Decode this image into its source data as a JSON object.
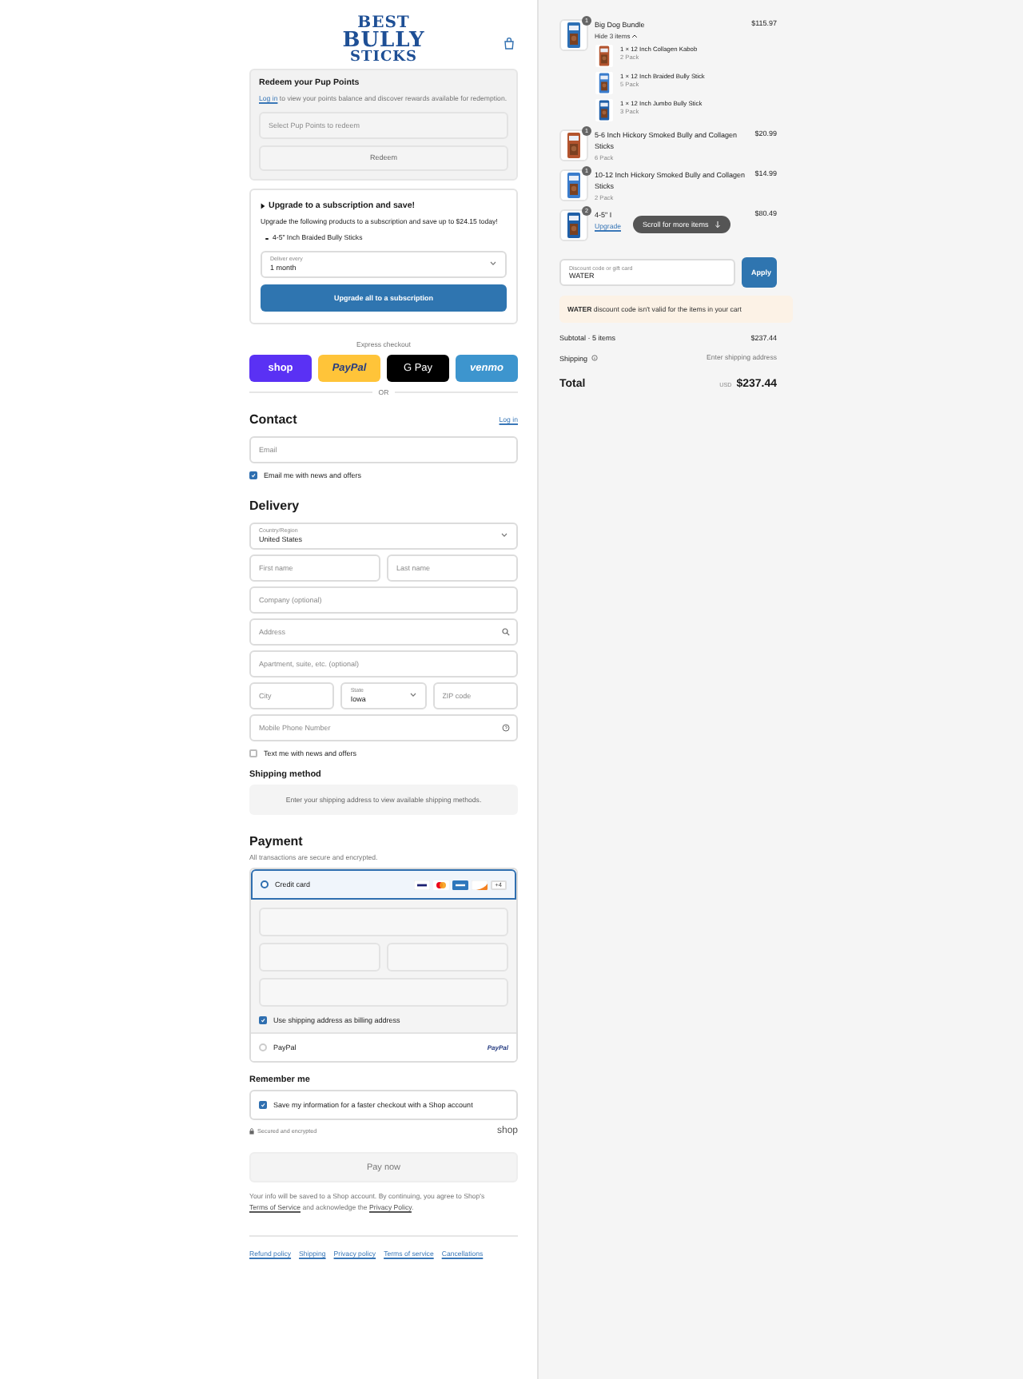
{
  "header": {
    "logo": [
      "BEST",
      "BULLY",
      "STICKS"
    ]
  },
  "points": {
    "title": "Redeem your Pup Points",
    "login_link": "Log in",
    "text": " to view your points balance and discover rewards available for redemption.",
    "select": {
      "placeholder": "Select Pup Points to redeem"
    },
    "button": "Redeem"
  },
  "upsell": {
    "title": "Upgrade to a subscription and save!",
    "text": "Upgrade the following products to a subscription and save up to $24.15 today!",
    "products": [
      "4-5\" Inch Braided Bully Sticks"
    ],
    "select_label": "Deliver every",
    "select_value": "1 month",
    "button": "Upgrade all to a subscription"
  },
  "express": {
    "title": "Express checkout",
    "buttons": [
      {
        "kind": "shop",
        "label": "shop"
      },
      {
        "kind": "paypal",
        "label": "PayPal"
      },
      {
        "kind": "gpay",
        "label": "G Pay"
      },
      {
        "kind": "venmo",
        "label": "venmo"
      }
    ],
    "or": "OR"
  },
  "contact": {
    "title": "Contact",
    "login": "Log in",
    "email": {
      "placeholder": "Email"
    },
    "news": {
      "label": "Email me with news and offers",
      "checked": true
    }
  },
  "delivery": {
    "title": "Delivery",
    "country_label": "Country/Region",
    "country": "United States",
    "first": {
      "placeholder": "First name"
    },
    "last": {
      "placeholder": "Last name"
    },
    "company": {
      "placeholder": "Company (optional)"
    },
    "address": {
      "placeholder": "Address"
    },
    "apartment": {
      "placeholder": "Apartment, suite, etc. (optional)"
    },
    "city": {
      "placeholder": "City"
    },
    "state_label": "State",
    "state": "Iowa",
    "zip": {
      "placeholder": "ZIP code"
    },
    "phone": {
      "placeholder": "Mobile Phone Number"
    },
    "text_me": {
      "label": "Text me with news and offers",
      "checked": false
    }
  },
  "shipping": {
    "title": "Shipping method",
    "notice": "Enter your shipping address to view available shipping methods."
  },
  "payment": {
    "title": "Payment",
    "subtitle": "All transactions are secure and encrypted.",
    "methods": [
      {
        "kind": "card",
        "label": "Credit card",
        "selected": true,
        "more": "+4"
      },
      {
        "kind": "paypal",
        "label": "PayPal",
        "selected": false,
        "logo": "PayPal"
      }
    ],
    "billing": {
      "label": "Use shipping address as billing address",
      "checked": true
    }
  },
  "remember": {
    "title": "Remember me",
    "save": {
      "label": "Save my information for a faster checkout with a Shop account",
      "checked": true
    },
    "secure": "Secured and encrypted",
    "shop": "shop"
  },
  "pay_button": "Pay now",
  "legal": {
    "before": "Your info will be saved to a Shop account. By continuing, you agree to Shop's ",
    "terms": "Terms of Service",
    "middle": " and acknowledge the ",
    "privacy": "Privacy Policy",
    "after": "."
  },
  "footer_links": [
    "Refund policy",
    "Shipping",
    "Privacy policy",
    "Terms of service",
    "Cancellations"
  ],
  "cart": {
    "items": [
      {
        "name": "Big Dog Bundle",
        "qty": "1",
        "price": "$115.97",
        "toggle": "Hide 3 items",
        "children": [
          {
            "name": "1 × 12 Inch Collagen Kabob",
            "variant": "2 Pack"
          },
          {
            "name": "1 × 12 Inch Braided Bully Stick",
            "variant": "5 Pack"
          },
          {
            "name": "1 × 12 Inch Jumbo Bully Stick",
            "variant": "3 Pack"
          }
        ]
      },
      {
        "name": "5-6 Inch Hickory Smoked Bully and Collagen Sticks",
        "qty": "1",
        "price": "$20.99",
        "variant": "6 Pack"
      },
      {
        "name": "10-12 Inch Hickory Smoked Bully and Collagen Sticks",
        "qty": "1",
        "price": "$14.99",
        "variant": "2 Pack"
      },
      {
        "name": "4-5\" I",
        "qty": "2",
        "price": "$80.49",
        "link": "Upgrade"
      }
    ],
    "scroll_hint": "Scroll for more items",
    "discount": {
      "label": "Discount code or gift card",
      "value": "WATER",
      "button": "Apply"
    },
    "warning": {
      "code": "WATER",
      "text": " discount code isn't valid for the items in your cart"
    },
    "subtotal": {
      "label": "Subtotal · 5 items",
      "value": "$237.44"
    },
    "shipping": {
      "label": "Shipping",
      "value": "Enter shipping address"
    },
    "total": {
      "label": "Total",
      "currency": "USD",
      "value": "$237.44"
    }
  }
}
